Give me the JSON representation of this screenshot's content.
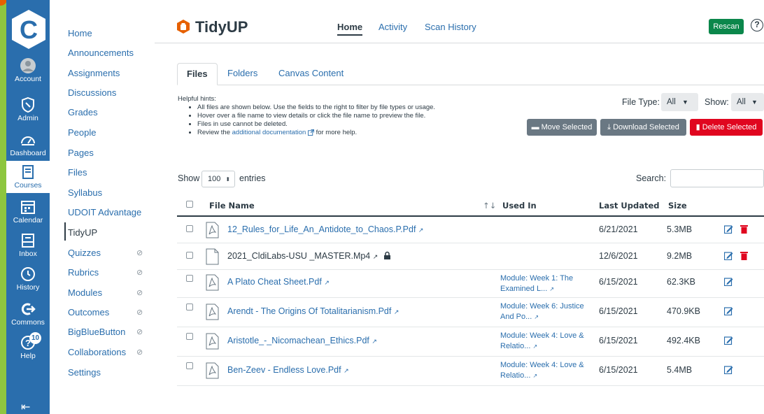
{
  "global_nav": {
    "items": [
      {
        "label": "Account",
        "icon": "account-icon"
      },
      {
        "label": "Admin",
        "icon": "admin-icon"
      },
      {
        "label": "Dashboard",
        "icon": "dashboard-icon"
      },
      {
        "label": "Courses",
        "icon": "courses-icon"
      },
      {
        "label": "Calendar",
        "icon": "calendar-icon"
      },
      {
        "label": "Inbox",
        "icon": "inbox-icon"
      },
      {
        "label": "History",
        "icon": "history-icon"
      },
      {
        "label": "Commons",
        "icon": "commons-icon"
      },
      {
        "label": "Help",
        "icon": "help-icon"
      }
    ],
    "help_badge": "10",
    "active": "Courses"
  },
  "course_nav": {
    "items": [
      {
        "label": "Home",
        "hidden": false
      },
      {
        "label": "Announcements",
        "hidden": false
      },
      {
        "label": "Assignments",
        "hidden": false
      },
      {
        "label": "Discussions",
        "hidden": false
      },
      {
        "label": "Grades",
        "hidden": false
      },
      {
        "label": "People",
        "hidden": false
      },
      {
        "label": "Pages",
        "hidden": false
      },
      {
        "label": "Files",
        "hidden": false
      },
      {
        "label": "Syllabus",
        "hidden": false
      },
      {
        "label": "UDOIT Advantage",
        "hidden": false
      },
      {
        "label": "TidyUP",
        "hidden": false
      },
      {
        "label": "Quizzes",
        "hidden": true
      },
      {
        "label": "Rubrics",
        "hidden": true
      },
      {
        "label": "Modules",
        "hidden": true
      },
      {
        "label": "Outcomes",
        "hidden": true
      },
      {
        "label": "BigBlueButton",
        "hidden": true
      },
      {
        "label": "Collaborations",
        "hidden": true
      },
      {
        "label": "Settings",
        "hidden": false
      }
    ],
    "active": "TidyUP"
  },
  "app": {
    "title": "TidyUP",
    "nav": [
      "Home",
      "Activity",
      "Scan History"
    ],
    "active_nav": "Home",
    "rescan_label": "Rescan",
    "help_label": "?"
  },
  "tabs": [
    "Files",
    "Folders",
    "Canvas Content"
  ],
  "active_tab": "Files",
  "hints": {
    "title": "Helpful hints:",
    "items": [
      "All files are shown below. Use the fields to the right to filter by file types or usage.",
      "Hover over a file name to view details or click the file name to preview the file.",
      "Files in use cannot be deleted."
    ],
    "last_prefix": "Review the",
    "doc_link": "additional documentation",
    "last_suffix": "for more help."
  },
  "filters": {
    "file_type_label": "File Type:",
    "file_type_value": "All",
    "show_label": "Show:",
    "show_value": "All"
  },
  "actions": {
    "move": "Move Selected",
    "download": "Download Selected",
    "delete": "Delete Selected"
  },
  "table_controls": {
    "show_label": "Show",
    "entries_value": "100",
    "entries_label": "entries",
    "search_label": "Search:"
  },
  "table": {
    "columns": [
      "File Name",
      "Used In",
      "Last Updated",
      "Size"
    ],
    "rows": [
      {
        "name": "12_Rules_for_Life_An_Antidote_to_Chaos.P.Pdf",
        "used_in": "",
        "updated": "6/21/2021",
        "size": "5.3MB",
        "type": "pdf",
        "deletable": true,
        "locked": false
      },
      {
        "name": "2021_CldiLabs-USU _MASTER.Mp4",
        "used_in": "",
        "updated": "12/6/2021",
        "size": "9.2MB",
        "type": "file",
        "deletable": true,
        "locked": true
      },
      {
        "name": "A Plato Cheat Sheet.Pdf",
        "used_in": "Module: Week 1: The Examined L...",
        "updated": "6/15/2021",
        "size": "62.3KB",
        "type": "pdf",
        "deletable": false,
        "locked": false
      },
      {
        "name": "Arendt - The Origins Of Totalitarianism.Pdf",
        "used_in": "Module: Week 6: Justice And Po...",
        "updated": "6/15/2021",
        "size": "470.9KB",
        "type": "pdf",
        "deletable": false,
        "locked": false
      },
      {
        "name": "Aristotle_-_Nicomachean_Ethics.Pdf",
        "used_in": "Module: Week 4: Love & Relatio...",
        "updated": "6/15/2021",
        "size": "492.4KB",
        "type": "pdf",
        "deletable": false,
        "locked": false
      },
      {
        "name": "Ben-Zeev - Endless Love.Pdf",
        "used_in": "Module: Week 4: Love & Relatio...",
        "updated": "6/15/2021",
        "size": "5.4MB",
        "type": "pdf",
        "deletable": false,
        "locked": false
      }
    ]
  },
  "colors": {
    "brand_blue": "#2a6ead",
    "canvas_green": "#8dc63f",
    "rescan_green": "#0b874b",
    "delete_red": "#e0061f",
    "tidyup_orange": "#e66000"
  }
}
